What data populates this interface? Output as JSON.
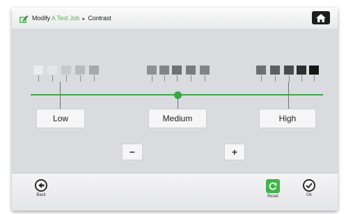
{
  "header": {
    "prefix": "Modify",
    "job_name": "A Test Job",
    "separator": "▸",
    "page": "Contrast"
  },
  "contrast": {
    "levels": [
      {
        "label": "Low"
      },
      {
        "label": "Medium"
      },
      {
        "label": "High"
      }
    ],
    "decrease_label": "−",
    "increase_label": "+",
    "selected_level": "Medium",
    "accent_color": "#3ea64a"
  },
  "footer": {
    "back_label": "Back",
    "reset_label": "Reset",
    "ok_label": "Ok"
  }
}
